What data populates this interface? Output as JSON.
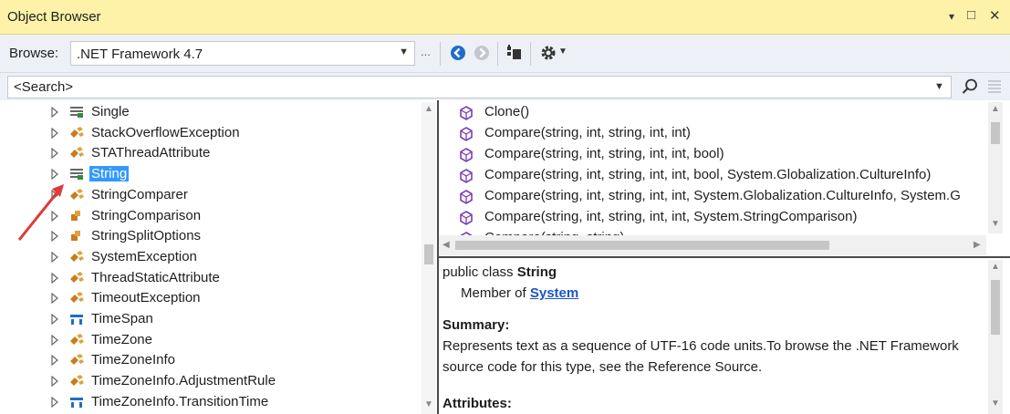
{
  "window": {
    "title": "Object Browser",
    "controls": [
      "▾",
      "□",
      "✕"
    ]
  },
  "toolbar": {
    "browse_label": "Browse:",
    "browse_value": ".NET Framework 4.7",
    "dots": "..."
  },
  "search": {
    "value": "<Search>"
  },
  "tree": {
    "items": [
      {
        "label": "Single",
        "icon": "struct-icon",
        "selected": false
      },
      {
        "label": "StackOverflowException",
        "icon": "class-icon",
        "selected": false
      },
      {
        "label": "STAThreadAttribute",
        "icon": "class-icon",
        "selected": false
      },
      {
        "label": "String",
        "icon": "struct-icon",
        "selected": true
      },
      {
        "label": "StringComparer",
        "icon": "class-icon",
        "selected": false
      },
      {
        "label": "StringComparison",
        "icon": "enum-icon",
        "selected": false
      },
      {
        "label": "StringSplitOptions",
        "icon": "enum-icon",
        "selected": false
      },
      {
        "label": "SystemException",
        "icon": "class-icon",
        "selected": false
      },
      {
        "label": "ThreadStaticAttribute",
        "icon": "class-icon",
        "selected": false
      },
      {
        "label": "TimeoutException",
        "icon": "class-icon",
        "selected": false
      },
      {
        "label": "TimeSpan",
        "icon": "struct-blue-icon",
        "selected": false
      },
      {
        "label": "TimeZone",
        "icon": "class-icon",
        "selected": false
      },
      {
        "label": "TimeZoneInfo",
        "icon": "class-icon",
        "selected": false
      },
      {
        "label": "TimeZoneInfo.AdjustmentRule",
        "icon": "class-icon",
        "selected": false
      },
      {
        "label": "TimeZoneInfo.TransitionTime",
        "icon": "struct-blue-icon",
        "selected": false
      }
    ]
  },
  "members": {
    "items": [
      {
        "label": "Clone()"
      },
      {
        "label": "Compare(string, int, string, int, int)"
      },
      {
        "label": "Compare(string, int, string, int, int, bool)"
      },
      {
        "label": "Compare(string, int, string, int, int, bool, System.Globalization.CultureInfo)"
      },
      {
        "label": "Compare(string, int, string, int, int, System.Globalization.CultureInfo, System.G"
      },
      {
        "label": "Compare(string, int, string, int, int, System.StringComparison)"
      },
      {
        "label": "Compare(string, string)"
      }
    ]
  },
  "description": {
    "decl_prefix": "public class ",
    "decl_name": "String",
    "member_of_prefix": "Member of ",
    "member_of_link": "System",
    "summary_heading": "Summary:",
    "summary_line1": "Represents text as a sequence of UTF-16 code units.To browse the .NET Framework",
    "summary_line2": "source code for this type, see the Reference Source.",
    "attributes_heading": "Attributes:"
  },
  "colors": {
    "title_bar": "#fdf2a8",
    "selection": "#3399ff",
    "link": "#1a55c8",
    "annotation_arrow": "#e03a3a",
    "class_icon": "#c77d1f",
    "method_icon": "#7b3fb5"
  }
}
